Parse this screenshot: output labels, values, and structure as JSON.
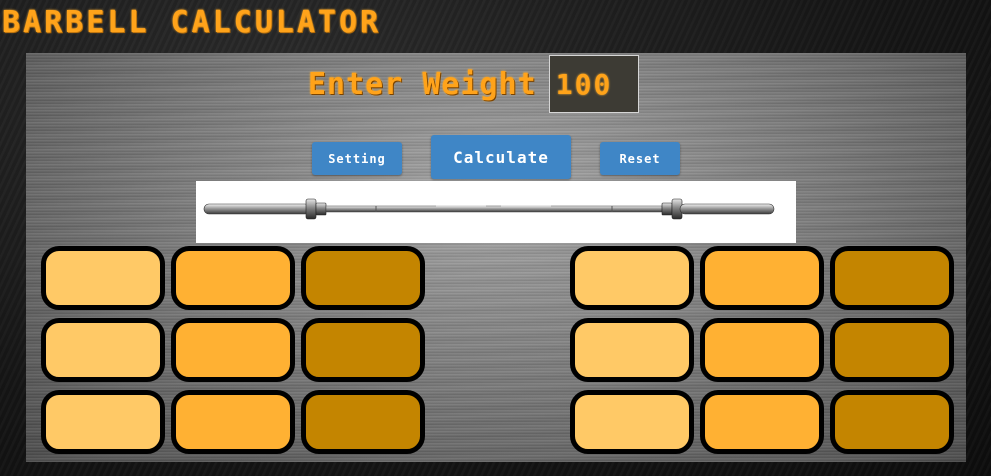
{
  "app": {
    "title": "BARBELL CALCULATOR"
  },
  "weight": {
    "label": "Enter Weight",
    "value": "100"
  },
  "buttons": {
    "setting": "Setting",
    "calculate": "Calculate",
    "reset": "Reset"
  },
  "colors": {
    "accent": "#ffa31a",
    "button": "#3f86c6",
    "plate_light": "#ffc966",
    "plate_medium": "#ffb133",
    "plate_dark": "#c48500"
  },
  "plates": {
    "left": [
      [
        "light",
        "medium",
        "dark"
      ],
      [
        "light",
        "medium",
        "dark"
      ],
      [
        "light",
        "medium",
        "dark"
      ]
    ],
    "right": [
      [
        "light",
        "medium",
        "dark"
      ],
      [
        "light",
        "medium",
        "dark"
      ],
      [
        "light",
        "medium",
        "dark"
      ]
    ]
  }
}
